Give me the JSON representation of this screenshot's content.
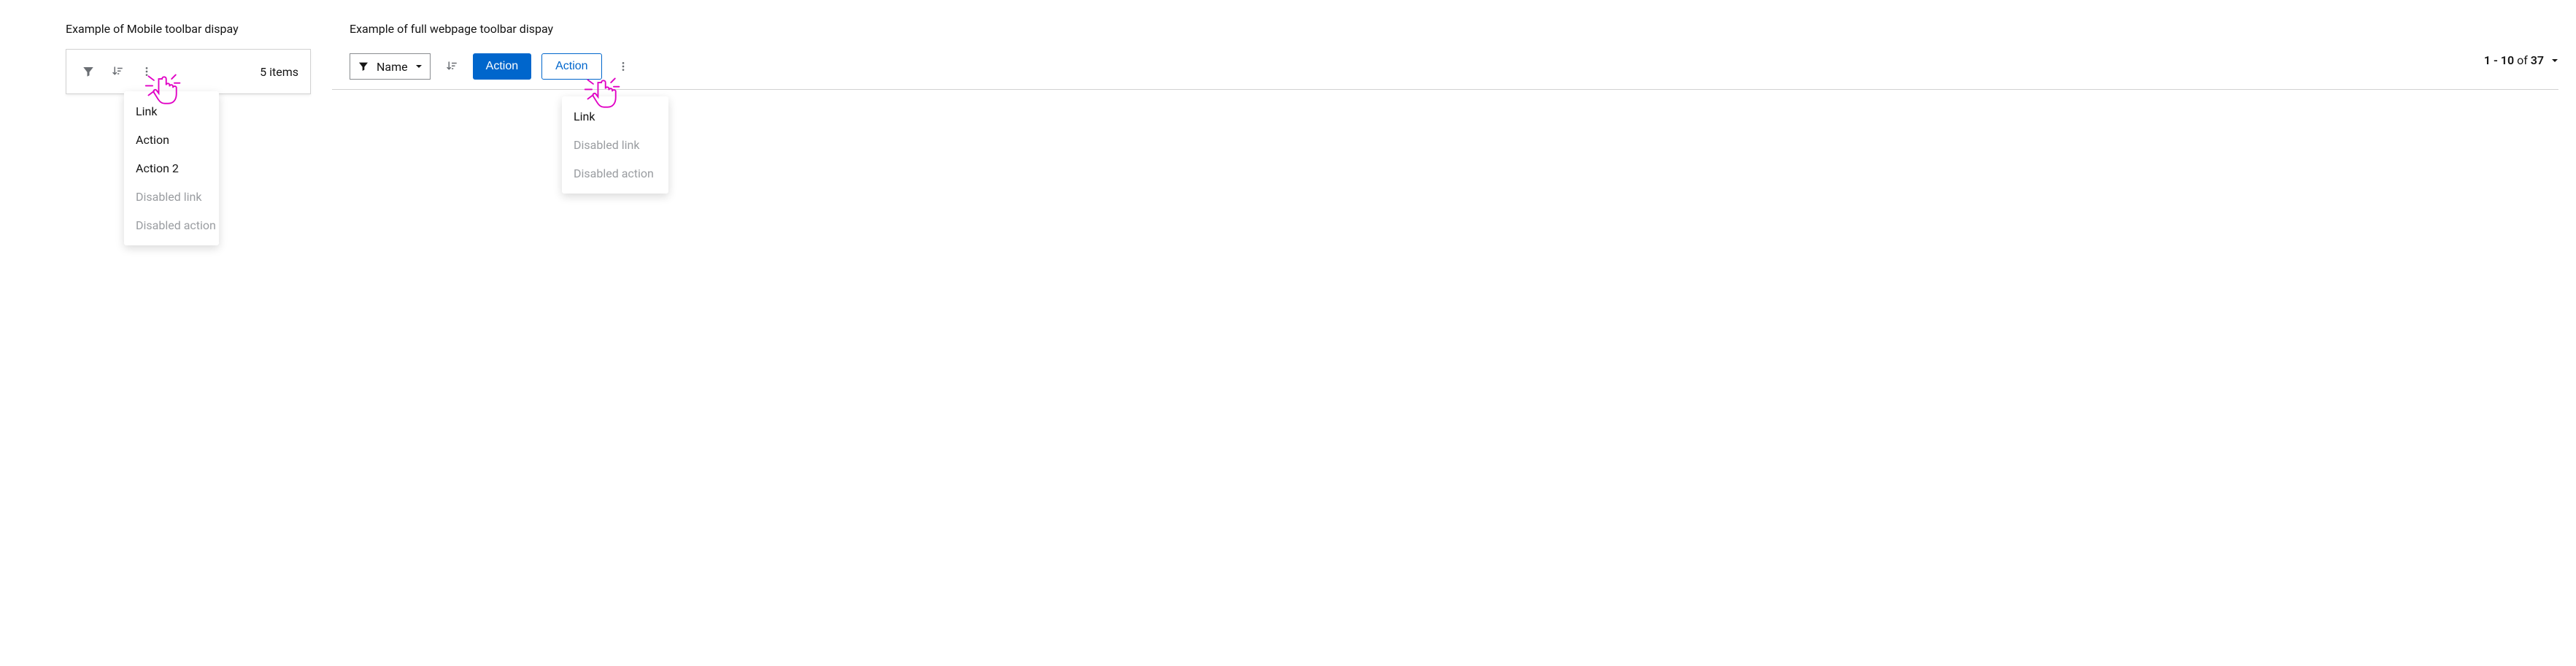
{
  "mobile": {
    "title": "Example of Mobile toolbar dispay",
    "item_count_text": "5 items",
    "menu": [
      {
        "label": "Link",
        "disabled": false
      },
      {
        "label": "Action",
        "disabled": false
      },
      {
        "label": "Action 2",
        "disabled": false
      },
      {
        "label": "Disabled link",
        "disabled": true
      },
      {
        "label": "Disabled action",
        "disabled": true
      }
    ]
  },
  "full": {
    "title": "Example of  full webpage  toolbar dispay",
    "filter_select_label": "Name",
    "primary_action_label": "Action",
    "secondary_action_label": "Action",
    "menu": [
      {
        "label": "Link",
        "disabled": false
      },
      {
        "label": "Disabled link",
        "disabled": true
      },
      {
        "label": "Disabled action",
        "disabled": true
      }
    ],
    "pagination": {
      "range": "1 - 10",
      "of_word": "of",
      "total": "37"
    }
  }
}
